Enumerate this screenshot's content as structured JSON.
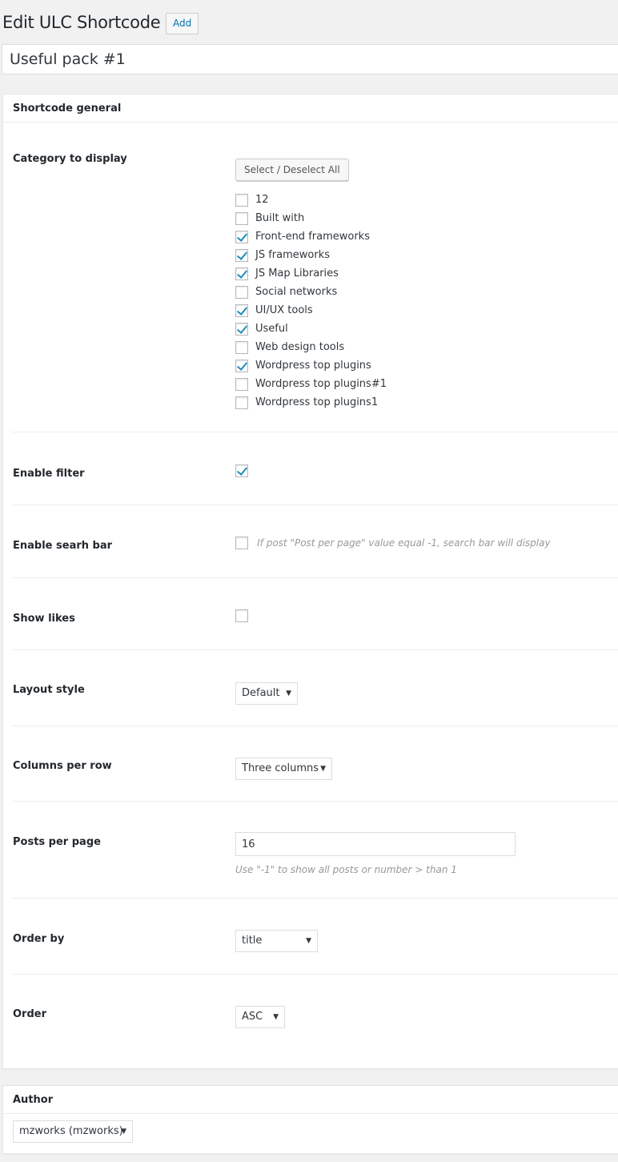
{
  "page": {
    "title": "Edit ULC Shortcode",
    "add_label": "Add",
    "name_value": "Useful pack #1"
  },
  "general": {
    "heading": "Shortcode general",
    "category": {
      "label": "Category to display",
      "select_all": "Select / Deselect All",
      "items": [
        {
          "label": "12",
          "checked": false
        },
        {
          "label": "Built with",
          "checked": false
        },
        {
          "label": "Front-end frameworks",
          "checked": true
        },
        {
          "label": "JS frameworks",
          "checked": true
        },
        {
          "label": "JS Map Libraries",
          "checked": true
        },
        {
          "label": "Social networks",
          "checked": false
        },
        {
          "label": "UI/UX tools",
          "checked": true
        },
        {
          "label": "Useful",
          "checked": true
        },
        {
          "label": "Web design tools",
          "checked": false
        },
        {
          "label": "Wordpress top plugins",
          "checked": true
        },
        {
          "label": "Wordpress top plugins#1",
          "checked": false
        },
        {
          "label": "Wordpress top plugins1",
          "checked": false
        }
      ]
    },
    "filter": {
      "label": "Enable filter",
      "checked": true
    },
    "search": {
      "label": "Enable searh bar",
      "checked": false,
      "hint": "If post \"Post per page\" value equal -1, search bar will display"
    },
    "likes": {
      "label": "Show likes",
      "checked": false
    },
    "layout": {
      "label": "Layout style",
      "value": "Default"
    },
    "columns": {
      "label": "Columns per row",
      "value": "Three columns"
    },
    "posts": {
      "label": "Posts per page",
      "value": "16",
      "hint": "Use \"-1\" to show all posts or number > than 1"
    },
    "orderby": {
      "label": "Order by",
      "value": "title"
    },
    "order": {
      "label": "Order",
      "value": "ASC"
    }
  },
  "author": {
    "heading": "Author",
    "value": "mzworks (mzworks)"
  },
  "colors": {
    "accent": "#0073aa",
    "check": "#1e8cbe"
  }
}
